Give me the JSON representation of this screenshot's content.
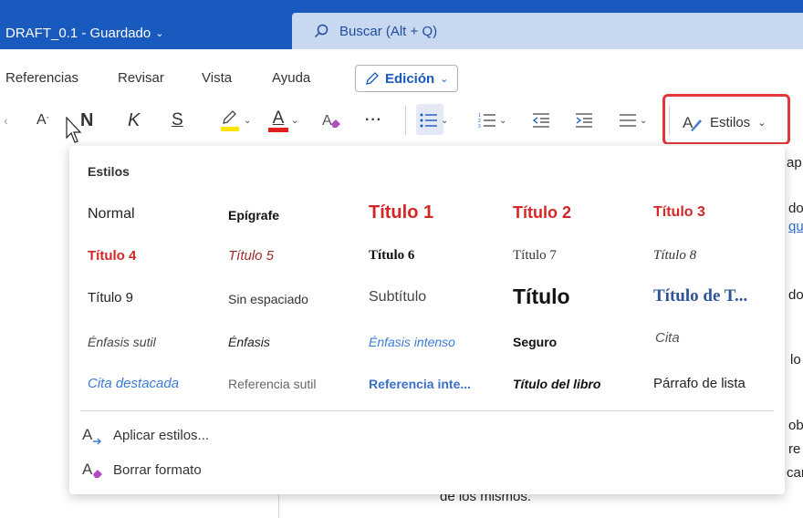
{
  "titlebar": {
    "doc_title": "DRAFT_0.1 - Guardado",
    "search_placeholder": "Buscar (Alt + Q)"
  },
  "menu": {
    "items": [
      "Referencias",
      "Revisar",
      "Vista",
      "Ayuda"
    ],
    "edit_mode": "Edición"
  },
  "toolbar": {
    "font_size_grow": "A",
    "bold": "N",
    "italic": "K",
    "underline": "S",
    "font_color": "A",
    "more": "···",
    "styles_label": "Estilos"
  },
  "colors": {
    "titlebar": "#185abd",
    "search": "#c8d8f1",
    "highlight_frame": "#e0383b",
    "heading_red": "#d42626",
    "heading_blue": "#2f5496",
    "link_blue": "#3a7bd5"
  },
  "styles_panel": {
    "title": "Estilos",
    "styles": [
      "Normal",
      "Epígrafe",
      "Título 1",
      "Título 2",
      "Título 3",
      "Título 4",
      "Título 5",
      "Título 6",
      "Título 7",
      "Título 8",
      "Título 9",
      "Sin espaciado",
      "Subtítulo",
      "Título",
      "Título de T...",
      "Énfasis sutil",
      "Énfasis",
      "Énfasis intenso",
      "Seguro",
      "Cita",
      "Cita destacada",
      "Referencia sutil",
      "Referencia inte...",
      "Título del libro",
      "Párrafo de lista"
    ],
    "actions": {
      "apply": "Aplicar estilos...",
      "clear": "Borrar formato"
    }
  },
  "document": {
    "fragments": [
      "ap",
      "do",
      "que",
      "do",
      "lo",
      "ob",
      "re",
      "can",
      "de los mismos."
    ]
  }
}
